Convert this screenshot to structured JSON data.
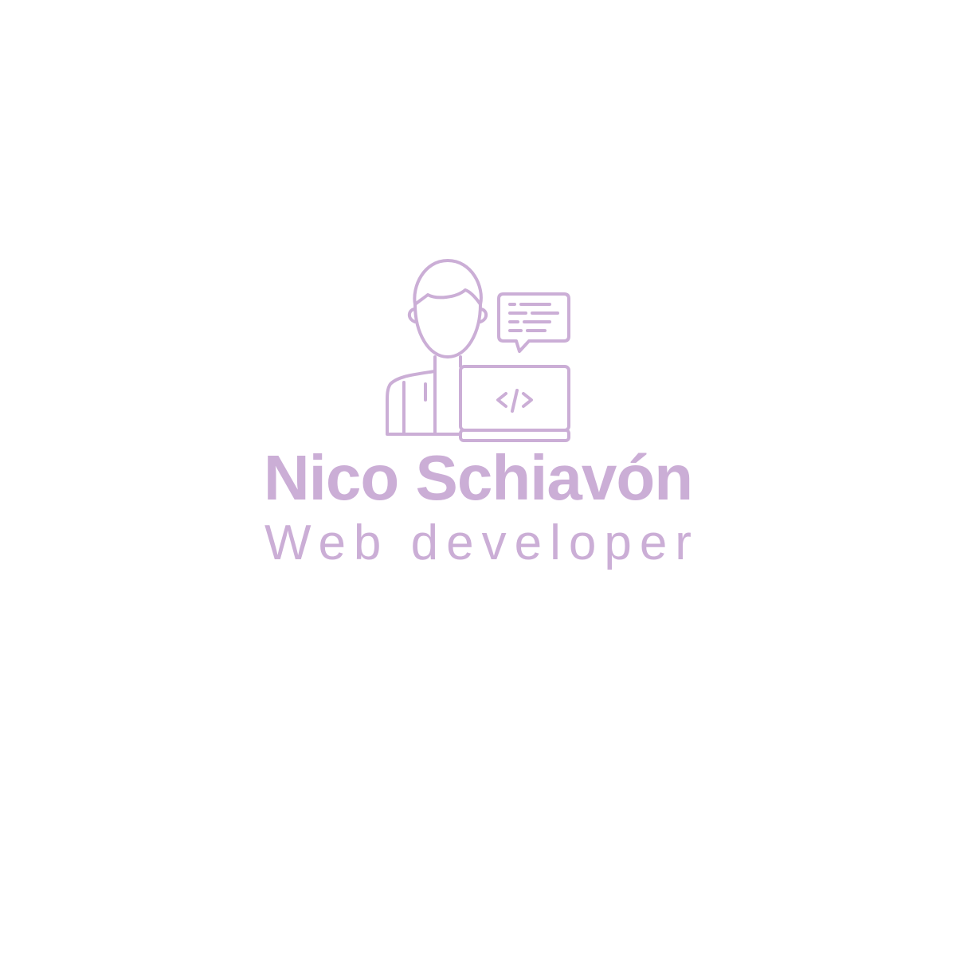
{
  "brand": {
    "name": "Nico Schiavón",
    "tagline": "Web developer",
    "color": "#cbaed6",
    "background": "#ffffff"
  },
  "icons": {
    "emblem": "developer-with-laptop-icon",
    "chat": "chat-bubble-icon",
    "code": "code-brackets-icon"
  }
}
